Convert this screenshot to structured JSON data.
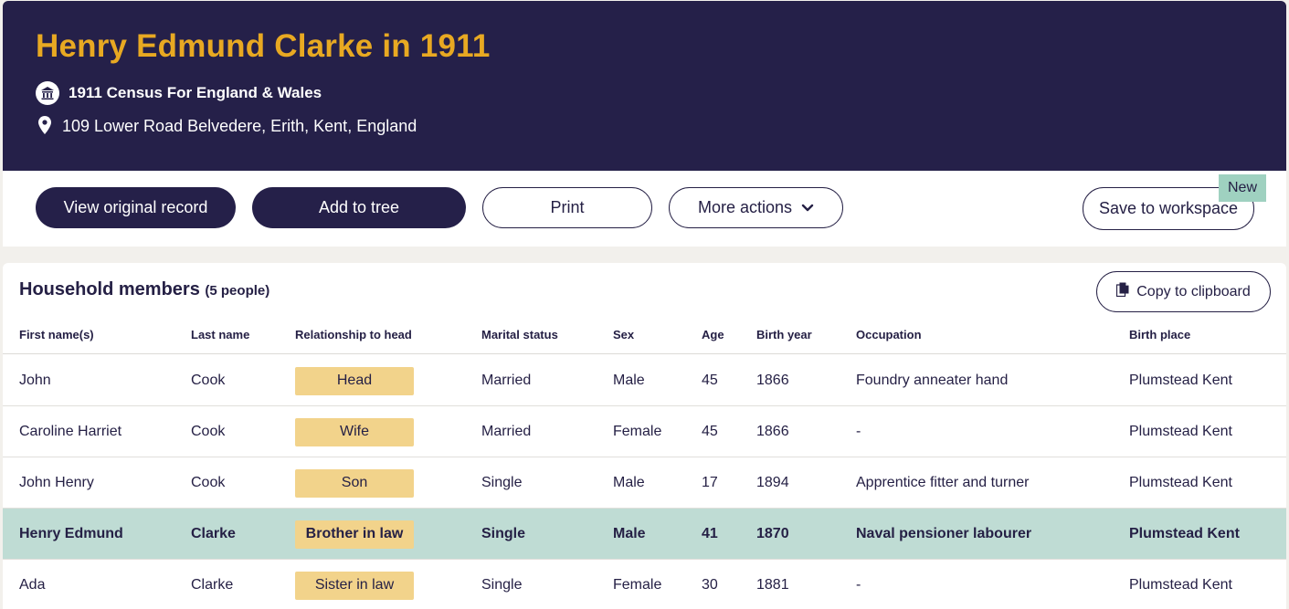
{
  "header": {
    "title": "Henry Edmund Clarke in 1911",
    "collection": "1911 Census For England & Wales",
    "address": "109 Lower Road Belvedere, Erith, Kent, England"
  },
  "actions": {
    "view_original": "View original record",
    "add_to_tree": "Add to tree",
    "print": "Print",
    "more_actions": "More actions",
    "save_workspace": "Save to workspace",
    "new_badge": "New"
  },
  "household": {
    "title": "Household members",
    "count": "(5 people)",
    "copy_label": "Copy to clipboard",
    "columns": [
      "First name(s)",
      "Last name",
      "Relationship to head",
      "Marital status",
      "Sex",
      "Age",
      "Birth year",
      "Occupation",
      "Birth place"
    ],
    "rows": [
      {
        "first": "John",
        "last": "Cook",
        "relationship": "Head",
        "marital": "Married",
        "sex": "Male",
        "age": "45",
        "birth_year": "1866",
        "occupation": "Foundry anneater hand",
        "birth_place": "Plumstead Kent",
        "highlighted": false
      },
      {
        "first": "Caroline Harriet",
        "last": "Cook",
        "relationship": "Wife",
        "marital": "Married",
        "sex": "Female",
        "age": "45",
        "birth_year": "1866",
        "occupation": "-",
        "birth_place": "Plumstead Kent",
        "highlighted": false
      },
      {
        "first": "John Henry",
        "last": "Cook",
        "relationship": "Son",
        "marital": "Single",
        "sex": "Male",
        "age": "17",
        "birth_year": "1894",
        "occupation": "Apprentice fitter and turner",
        "birth_place": "Plumstead Kent",
        "highlighted": false
      },
      {
        "first": "Henry Edmund",
        "last": "Clarke",
        "relationship": "Brother in law",
        "marital": "Single",
        "sex": "Male",
        "age": "41",
        "birth_year": "1870",
        "occupation": "Naval pensioner labourer",
        "birth_place": "Plumstead Kent",
        "highlighted": true
      },
      {
        "first": "Ada",
        "last": "Clarke",
        "relationship": "Sister in law",
        "marital": "Single",
        "sex": "Female",
        "age": "30",
        "birth_year": "1881",
        "occupation": "-",
        "birth_place": "Plumstead Kent",
        "highlighted": false
      }
    ]
  },
  "icons": {
    "census": "census-building-icon",
    "location": "location-pin-icon",
    "chevron": "chevron-down-icon",
    "copy": "copy-document-icon"
  },
  "colors": {
    "header_bg": "#252049",
    "title": "#e8a922",
    "highlight_row": "#bfdcd4",
    "relationship_badge": "#f2d38b",
    "new_badge": "#9fd1c0"
  }
}
